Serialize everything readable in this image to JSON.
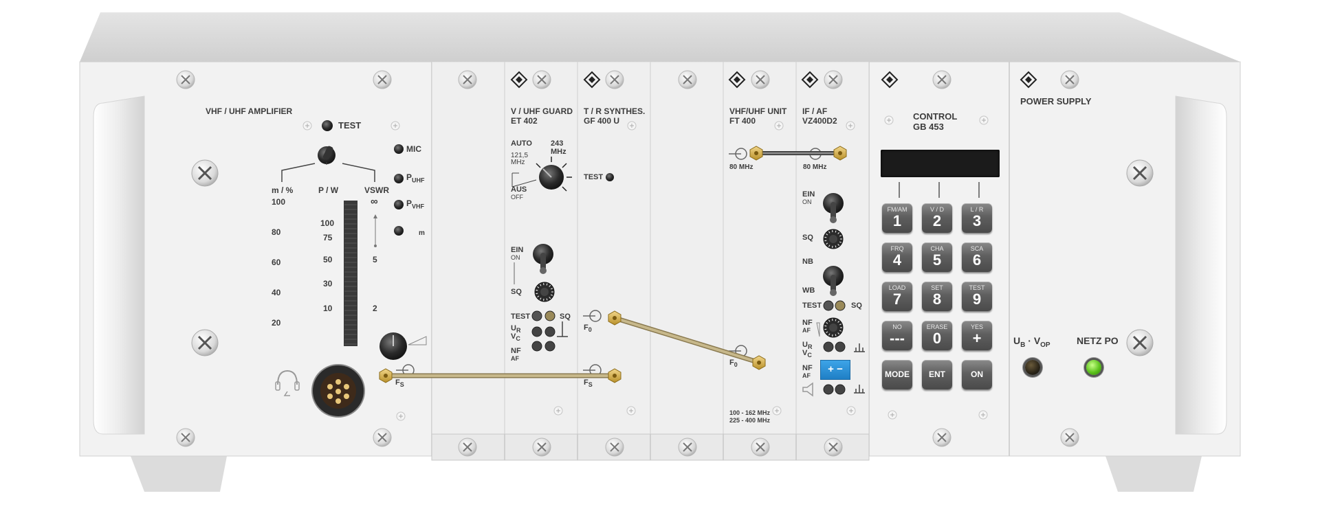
{
  "amplifier": {
    "title": "VHF / UHF AMPLIFIER",
    "test": "TEST",
    "mic": "MIC",
    "p_uhf": "P",
    "p_uhf_sub": "UHF",
    "p_vhf": "P",
    "p_vhf_sub": "VHF",
    "m": "m",
    "col_m": "m / %",
    "col_p": "P / W",
    "col_vswr": "VSWR",
    "scale_m": [
      "100",
      "80",
      "60",
      "40",
      "20"
    ],
    "scale_p": [
      "100",
      "75",
      "50",
      "30",
      "10"
    ],
    "scale_vswr": [
      "∞",
      "5",
      "2"
    ],
    "fs": "F",
    "fs_sub": "S"
  },
  "guard": {
    "title1": "V / UHF GUARD",
    "title2": "ET 402",
    "auto": "AUTO",
    "f121": "121,5",
    "mhz1": "MHz",
    "f243": "243",
    "mhz2": "MHz",
    "aus": "AUS",
    "off": "OFF",
    "ein": "EIN",
    "on": "ON",
    "sq": "SQ",
    "test": "TEST",
    "sq2": "SQ",
    "ur": "U",
    "ur_sub": "R",
    "vc": "V",
    "vc_sub": "C",
    "nf": "NF",
    "af": "AF"
  },
  "synth": {
    "title1": "T / R SYNTHES.",
    "title2": "GF 400 U",
    "test": "TEST",
    "f0": "F",
    "f0_sub": "0",
    "fs": "F",
    "fs_sub": "S"
  },
  "unit": {
    "title1": "VHF/UHF UNIT",
    "title2": "FT 400",
    "mhz80": "80 MHz",
    "f0": "F",
    "f0_sub": "0",
    "range1": "100 - 162 MHz",
    "range2": "225 - 400 MHz"
  },
  "ifaf": {
    "title1": "IF / AF",
    "title2": "VZ400D2",
    "mhz80": "80 MHz",
    "ein": "EIN",
    "on": "ON",
    "sq": "SQ",
    "nb": "NB",
    "wb": "WB",
    "test": "TEST",
    "sq2": "SQ",
    "nf": "NF",
    "af": "AF",
    "ur": "U",
    "ur_sub": "R",
    "vc": "V",
    "vc_sub": "C",
    "nf2": "NF",
    "af2": "AF",
    "plusminus": "+ −"
  },
  "control": {
    "title1": "CONTROL",
    "title2": "GB 453",
    "keys": [
      {
        "sub": "FM/AM",
        "main": "1"
      },
      {
        "sub": "V / D",
        "main": "2"
      },
      {
        "sub": "L / R",
        "main": "3"
      },
      {
        "sub": "FRQ",
        "main": "4"
      },
      {
        "sub": "CHA",
        "main": "5"
      },
      {
        "sub": "SCA",
        "main": "6"
      },
      {
        "sub": "LOAD",
        "main": "7"
      },
      {
        "sub": "SET",
        "main": "8"
      },
      {
        "sub": "TEST",
        "main": "9"
      },
      {
        "sub": "NO",
        "main": "---"
      },
      {
        "sub": "ERASE",
        "main": "0"
      },
      {
        "sub": "YES",
        "main": "+"
      },
      {
        "sub": "",
        "main": "MODE"
      },
      {
        "sub": "",
        "main": "ENT"
      },
      {
        "sub": "",
        "main": "ON"
      }
    ]
  },
  "power": {
    "title": "POWER SUPPLY",
    "ub": "U",
    "ub_sub": "B",
    "dot": " · ",
    "vop": "V",
    "vop_sub": "OP",
    "netz": "NETZ PO"
  },
  "colors": {
    "panel": "#f2f2f2",
    "chassis_top": "#d6d6d6",
    "cable": "#b3a47a",
    "connector": "#d7b34a",
    "key": "#5f5f5f",
    "led_green": "#5cc21c",
    "pm_blue": "#2a8fd6"
  }
}
